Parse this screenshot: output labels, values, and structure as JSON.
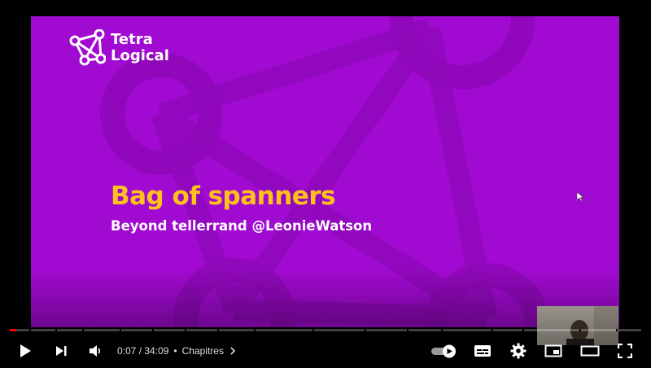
{
  "slide": {
    "logo": {
      "line1": "Tetra",
      "line2": "Logical"
    },
    "title": "Bag of spanners",
    "subtitle": "Beyond tellerrand @LeonieWatson"
  },
  "player": {
    "current_time": "0:07",
    "duration": "34:09",
    "time_separator": " / ",
    "separator_dot": "•",
    "chapters_label": "Chapitres",
    "progress_fraction": 0.0034,
    "autoplay_on": true,
    "colors": {
      "slide_bg": "#a10ad1",
      "title": "#ffc21a",
      "progress": "#ff0000"
    }
  },
  "icons": [
    "play-icon",
    "next-icon",
    "volume-icon",
    "chapter-chevron-icon",
    "autoplay-toggle",
    "subtitles-icon",
    "settings-gear-icon",
    "miniplayer-icon",
    "theater-mode-icon",
    "fullscreen-icon"
  ]
}
